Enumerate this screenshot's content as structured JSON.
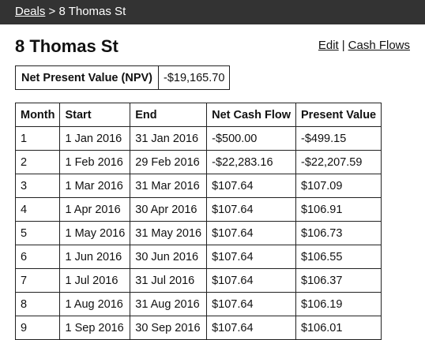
{
  "breadcrumb": {
    "root_label": "Deals",
    "separator": ">",
    "current": "8 Thomas St"
  },
  "page": {
    "title": "8 Thomas St"
  },
  "actions": {
    "edit_label": "Edit",
    "separator": "|",
    "cash_flows_label": "Cash Flows"
  },
  "npv": {
    "label": "Net Present Value (NPV)",
    "value": "-$19,165.70"
  },
  "table": {
    "columns": [
      "Month",
      "Start",
      "End",
      "Net Cash Flow",
      "Present Value"
    ],
    "rows": [
      [
        "1",
        "1 Jan 2016",
        "31 Jan 2016",
        "-$500.00",
        "-$499.15"
      ],
      [
        "2",
        "1 Feb 2016",
        "29 Feb 2016",
        "-$22,283.16",
        "-$22,207.59"
      ],
      [
        "3",
        "1 Mar 2016",
        "31 Mar 2016",
        "$107.64",
        "$107.09"
      ],
      [
        "4",
        "1 Apr 2016",
        "30 Apr 2016",
        "$107.64",
        "$106.91"
      ],
      [
        "5",
        "1 May 2016",
        "31 May 2016",
        "$107.64",
        "$106.73"
      ],
      [
        "6",
        "1 Jun 2016",
        "30 Jun 2016",
        "$107.64",
        "$106.55"
      ],
      [
        "7",
        "1 Jul 2016",
        "31 Jul 2016",
        "$107.64",
        "$106.37"
      ],
      [
        "8",
        "1 Aug 2016",
        "31 Aug 2016",
        "$107.64",
        "$106.19"
      ],
      [
        "9",
        "1 Sep 2016",
        "30 Sep 2016",
        "$107.64",
        "$106.01"
      ]
    ]
  }
}
